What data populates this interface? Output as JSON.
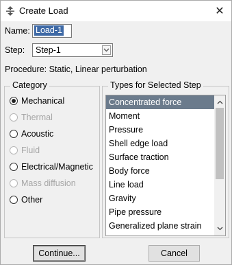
{
  "window": {
    "title": "Create Load",
    "close_glyph": "✕",
    "icon": "create-load-icon"
  },
  "form": {
    "name_label": "Name:",
    "name_value": "Load-1",
    "step_label": "Step:",
    "step_value": "Step-1",
    "procedure": "Procedure:  Static, Linear perturbation"
  },
  "category": {
    "title": "Category",
    "options": [
      {
        "label": "Mechanical",
        "checked": true,
        "enabled": true
      },
      {
        "label": "Thermal",
        "checked": false,
        "enabled": false
      },
      {
        "label": "Acoustic",
        "checked": false,
        "enabled": true
      },
      {
        "label": "Fluid",
        "checked": false,
        "enabled": false
      },
      {
        "label": "Electrical/Magnetic",
        "checked": false,
        "enabled": true
      },
      {
        "label": "Mass diffusion",
        "checked": false,
        "enabled": false
      },
      {
        "label": "Other",
        "checked": false,
        "enabled": true
      }
    ]
  },
  "types": {
    "title": "Types for Selected Step",
    "items": [
      "Concentrated force",
      "Moment",
      "Pressure",
      "Shell edge load",
      "Surface traction",
      "Body force",
      "Line load",
      "Gravity",
      "Pipe pressure",
      "Generalized plane strain"
    ],
    "selected_index": 0
  },
  "buttons": {
    "continue": "Continue...",
    "cancel": "Cancel"
  },
  "colors": {
    "selection": "#6b7b8c",
    "name_highlight": "#3f6aa6"
  }
}
